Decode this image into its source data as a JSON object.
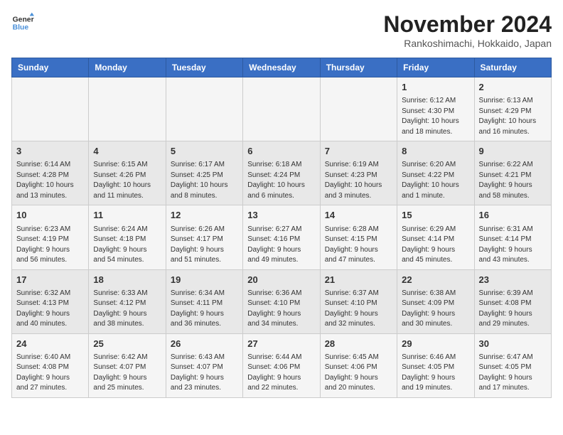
{
  "logo": {
    "line1": "General",
    "line2": "Blue"
  },
  "title": "November 2024",
  "location": "Rankoshimachi, Hokkaido, Japan",
  "days_of_week": [
    "Sunday",
    "Monday",
    "Tuesday",
    "Wednesday",
    "Thursday",
    "Friday",
    "Saturday"
  ],
  "weeks": [
    [
      {
        "day": "",
        "info": ""
      },
      {
        "day": "",
        "info": ""
      },
      {
        "day": "",
        "info": ""
      },
      {
        "day": "",
        "info": ""
      },
      {
        "day": "",
        "info": ""
      },
      {
        "day": "1",
        "info": "Sunrise: 6:12 AM\nSunset: 4:30 PM\nDaylight: 10 hours\nand 18 minutes."
      },
      {
        "day": "2",
        "info": "Sunrise: 6:13 AM\nSunset: 4:29 PM\nDaylight: 10 hours\nand 16 minutes."
      }
    ],
    [
      {
        "day": "3",
        "info": "Sunrise: 6:14 AM\nSunset: 4:28 PM\nDaylight: 10 hours\nand 13 minutes."
      },
      {
        "day": "4",
        "info": "Sunrise: 6:15 AM\nSunset: 4:26 PM\nDaylight: 10 hours\nand 11 minutes."
      },
      {
        "day": "5",
        "info": "Sunrise: 6:17 AM\nSunset: 4:25 PM\nDaylight: 10 hours\nand 8 minutes."
      },
      {
        "day": "6",
        "info": "Sunrise: 6:18 AM\nSunset: 4:24 PM\nDaylight: 10 hours\nand 6 minutes."
      },
      {
        "day": "7",
        "info": "Sunrise: 6:19 AM\nSunset: 4:23 PM\nDaylight: 10 hours\nand 3 minutes."
      },
      {
        "day": "8",
        "info": "Sunrise: 6:20 AM\nSunset: 4:22 PM\nDaylight: 10 hours\nand 1 minute."
      },
      {
        "day": "9",
        "info": "Sunrise: 6:22 AM\nSunset: 4:21 PM\nDaylight: 9 hours\nand 58 minutes."
      }
    ],
    [
      {
        "day": "10",
        "info": "Sunrise: 6:23 AM\nSunset: 4:19 PM\nDaylight: 9 hours\nand 56 minutes."
      },
      {
        "day": "11",
        "info": "Sunrise: 6:24 AM\nSunset: 4:18 PM\nDaylight: 9 hours\nand 54 minutes."
      },
      {
        "day": "12",
        "info": "Sunrise: 6:26 AM\nSunset: 4:17 PM\nDaylight: 9 hours\nand 51 minutes."
      },
      {
        "day": "13",
        "info": "Sunrise: 6:27 AM\nSunset: 4:16 PM\nDaylight: 9 hours\nand 49 minutes."
      },
      {
        "day": "14",
        "info": "Sunrise: 6:28 AM\nSunset: 4:15 PM\nDaylight: 9 hours\nand 47 minutes."
      },
      {
        "day": "15",
        "info": "Sunrise: 6:29 AM\nSunset: 4:14 PM\nDaylight: 9 hours\nand 45 minutes."
      },
      {
        "day": "16",
        "info": "Sunrise: 6:31 AM\nSunset: 4:14 PM\nDaylight: 9 hours\nand 43 minutes."
      }
    ],
    [
      {
        "day": "17",
        "info": "Sunrise: 6:32 AM\nSunset: 4:13 PM\nDaylight: 9 hours\nand 40 minutes."
      },
      {
        "day": "18",
        "info": "Sunrise: 6:33 AM\nSunset: 4:12 PM\nDaylight: 9 hours\nand 38 minutes."
      },
      {
        "day": "19",
        "info": "Sunrise: 6:34 AM\nSunset: 4:11 PM\nDaylight: 9 hours\nand 36 minutes."
      },
      {
        "day": "20",
        "info": "Sunrise: 6:36 AM\nSunset: 4:10 PM\nDaylight: 9 hours\nand 34 minutes."
      },
      {
        "day": "21",
        "info": "Sunrise: 6:37 AM\nSunset: 4:10 PM\nDaylight: 9 hours\nand 32 minutes."
      },
      {
        "day": "22",
        "info": "Sunrise: 6:38 AM\nSunset: 4:09 PM\nDaylight: 9 hours\nand 30 minutes."
      },
      {
        "day": "23",
        "info": "Sunrise: 6:39 AM\nSunset: 4:08 PM\nDaylight: 9 hours\nand 29 minutes."
      }
    ],
    [
      {
        "day": "24",
        "info": "Sunrise: 6:40 AM\nSunset: 4:08 PM\nDaylight: 9 hours\nand 27 minutes."
      },
      {
        "day": "25",
        "info": "Sunrise: 6:42 AM\nSunset: 4:07 PM\nDaylight: 9 hours\nand 25 minutes."
      },
      {
        "day": "26",
        "info": "Sunrise: 6:43 AM\nSunset: 4:07 PM\nDaylight: 9 hours\nand 23 minutes."
      },
      {
        "day": "27",
        "info": "Sunrise: 6:44 AM\nSunset: 4:06 PM\nDaylight: 9 hours\nand 22 minutes."
      },
      {
        "day": "28",
        "info": "Sunrise: 6:45 AM\nSunset: 4:06 PM\nDaylight: 9 hours\nand 20 minutes."
      },
      {
        "day": "29",
        "info": "Sunrise: 6:46 AM\nSunset: 4:05 PM\nDaylight: 9 hours\nand 19 minutes."
      },
      {
        "day": "30",
        "info": "Sunrise: 6:47 AM\nSunset: 4:05 PM\nDaylight: 9 hours\nand 17 minutes."
      }
    ]
  ]
}
